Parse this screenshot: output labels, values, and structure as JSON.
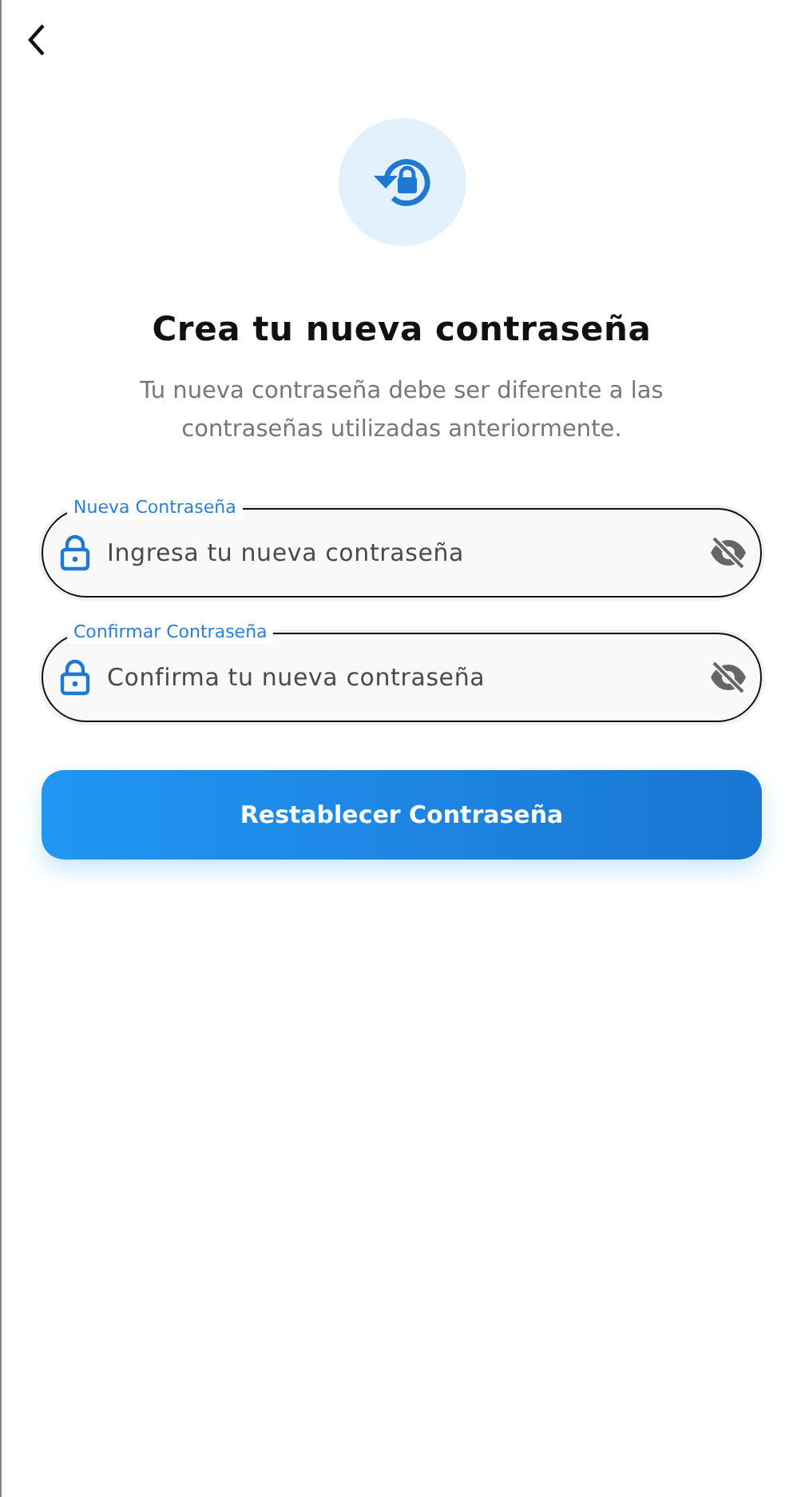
{
  "title": "Crea tu nueva contraseña",
  "subtitle": "Tu nueva contraseña debe ser diferente a las contraseñas utilizadas anteriormente.",
  "fields": [
    {
      "label": "Nueva Contraseña",
      "placeholder": "Ingresa tu nueva contraseña"
    },
    {
      "label": "Confirmar Contraseña",
      "placeholder": "Confirma tu nueva contraseña"
    }
  ],
  "button": "Restablecer Contraseña"
}
